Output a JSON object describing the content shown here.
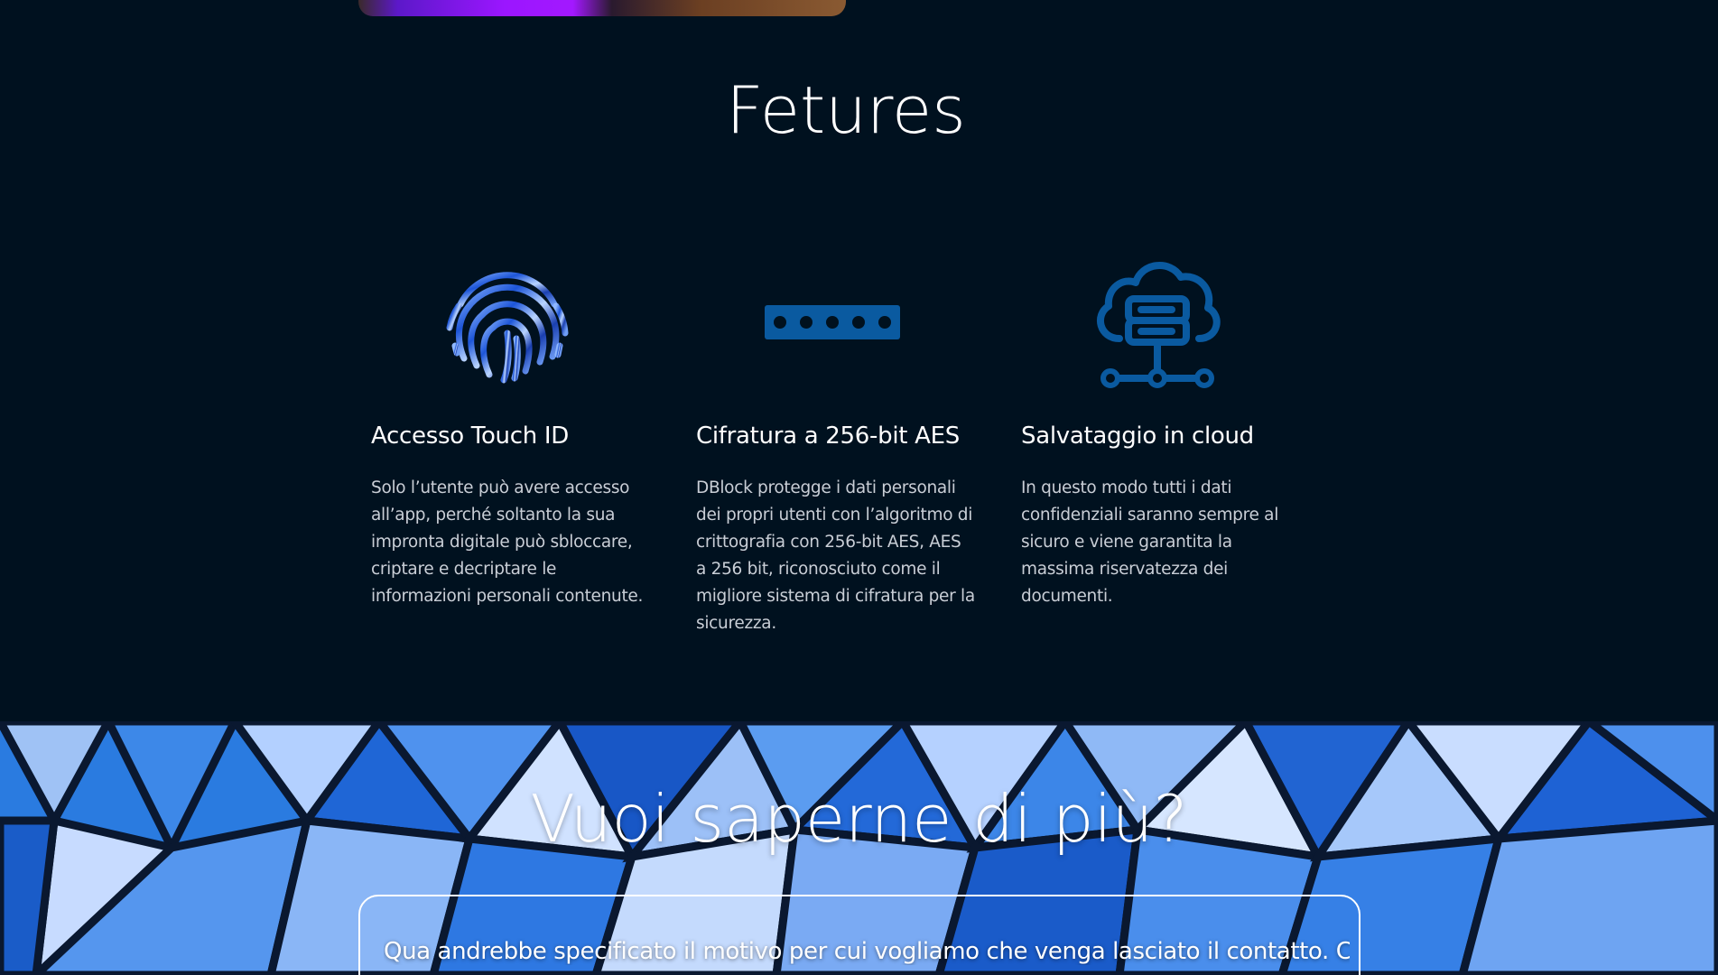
{
  "features": {
    "title": "Fetures",
    "items": [
      {
        "icon": "fingerprint-icon",
        "heading": "Accesso Touch ID",
        "text": "Solo l’utente può avere accesso all’app, perché soltanto la sua impronta digitale può sbloccare, criptare e decriptare le informazioni personali contenute."
      },
      {
        "icon": "password-dots-icon",
        "heading": "Cifratura a 256-bit AES",
        "text": "DBlock protegge i dati personali dei propri utenti con l’algoritmo di crittografia con 256-bit AES, AES a 256 bit, riconosciuto come il migliore sistema di cifratura per la sicurezza."
      },
      {
        "icon": "cloud-server-icon",
        "heading": "Salvataggio in cloud",
        "text": "In questo modo tutti i dati confidenziali saranno sempre al sicuro e viene garantita la massima riservatezza dei documenti."
      }
    ]
  },
  "contact": {
    "title": "Vuoi saperne di più?",
    "text": "Qua andrebbe specificato il motivo per cui vogliamo che venga lasciato il contatto. Che tipo"
  },
  "colors": {
    "background": "#00111f",
    "icon_blue": "#0a5aa0",
    "text_muted": "#c9ced6"
  }
}
